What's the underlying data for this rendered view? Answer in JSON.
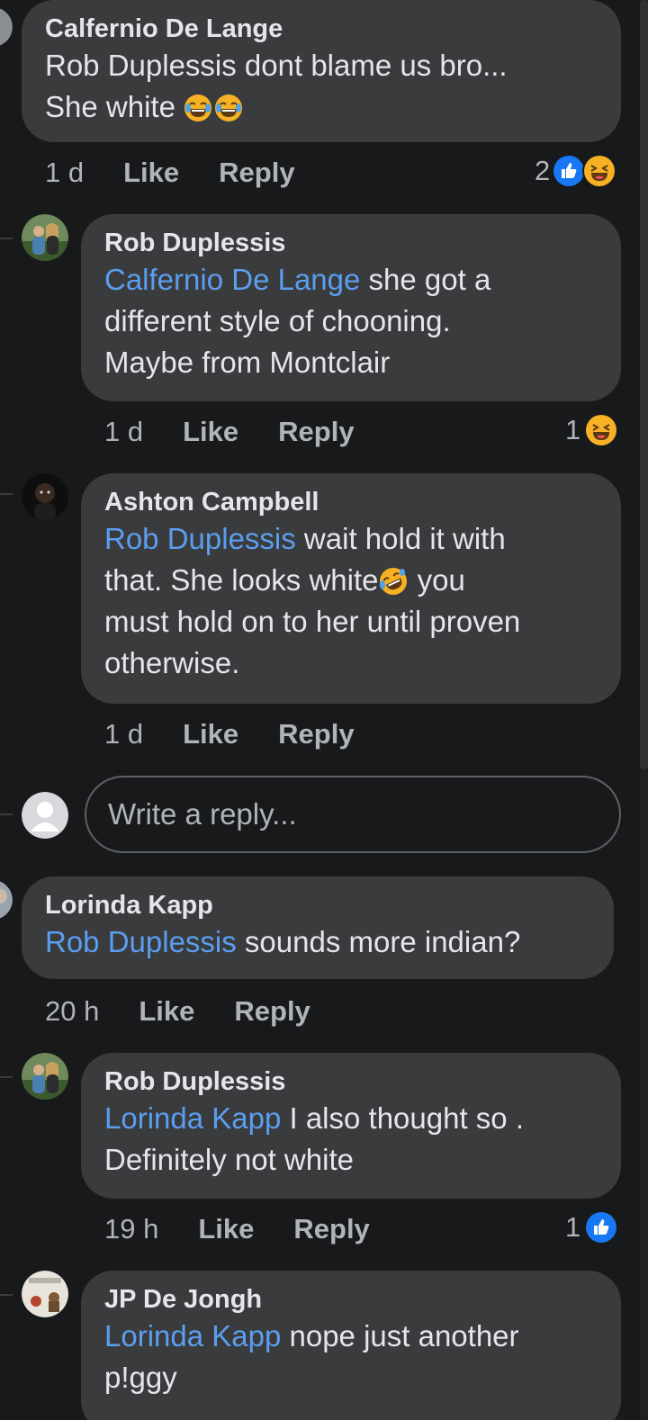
{
  "comments": [
    {
      "author": "Calfernio De Lange",
      "line1": "Rob Duplessis dont blame us bro...",
      "line2_prefix": "She white",
      "time": "1 d",
      "like": "Like",
      "reply": "Reply",
      "reaction_count": "2"
    },
    {
      "author": "Rob Duplessis",
      "mention": "Calfernio De Lange",
      "line1_suffix": " she got a",
      "line2": "different style of chooning.",
      "line3": "Maybe from Montclair",
      "time": "1 d",
      "like": "Like",
      "reply": "Reply",
      "reaction_count": "1"
    },
    {
      "author": "Ashton Campbell",
      "mention": "Rob Duplessis",
      "line1_suffix": " wait hold it with",
      "line2_prefix": "that. She looks white",
      "line2_suffix": " you",
      "line3": "must hold on to her until proven",
      "line4": "otherwise.",
      "time": "1 d",
      "like": "Like",
      "reply": "Reply"
    },
    {
      "author": "Lorinda Kapp",
      "mention": "Rob Duplessis",
      "line1_suffix": " sounds more indian?",
      "time": "20 h",
      "like": "Like",
      "reply": "Reply"
    },
    {
      "author": "Rob Duplessis",
      "mention": "Lorinda Kapp",
      "line1_suffix": " I also thought so .",
      "line2": "Definitely not white",
      "time": "19 h",
      "like": "Like",
      "reply": "Reply",
      "reaction_count": "1"
    },
    {
      "author": "JP De Jongh",
      "mention": "Lorinda Kapp",
      "line1_suffix": " nope just another",
      "line2": "p!ggy"
    }
  ],
  "reply_box": {
    "placeholder": "Write a reply..."
  },
  "icons": {
    "like": "thumbs-up-icon",
    "haha": "laughing-face-icon",
    "crying_laughing": "tears-of-joy-emoji",
    "rofl": "rolling-laughing-emoji",
    "default_avatar": "person-placeholder-icon"
  },
  "colors": {
    "background": "#18191a",
    "bubble": "#3a3b3c",
    "mention": "#5b9ef0",
    "like_blue": "#1877f2",
    "haha_yellow": "#f7b125"
  }
}
